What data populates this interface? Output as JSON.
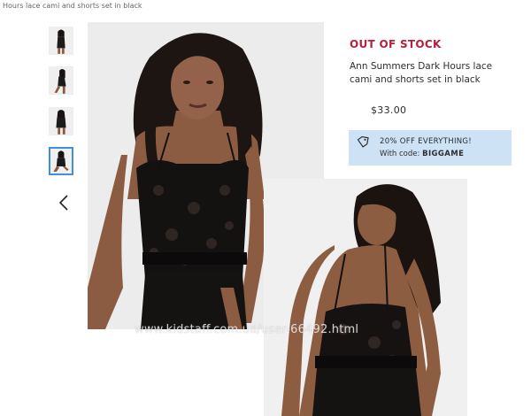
{
  "breadcrumb": "Hours lace cami and shorts set in black",
  "product": {
    "stock_status": "OUT OF STOCK",
    "title": "Ann Summers Dark Hours lace cami and shorts set in black",
    "price": "$33.00"
  },
  "promo": {
    "headline": "20% OFF EVERYTHING!",
    "code_prefix": "With code: ",
    "code": "BIGGAME",
    "icon": "tag-icon",
    "background": "#cde2f5"
  },
  "gallery": {
    "thumbnail_count": 4,
    "active_thumbnail": 4,
    "prev_icon": "chevron-left-icon"
  },
  "watermark": "www.kidstaff.com.ua/user-66492.html",
  "colors": {
    "stock": "#b71f3b",
    "active_thumb_border": "#3f8fdc"
  }
}
